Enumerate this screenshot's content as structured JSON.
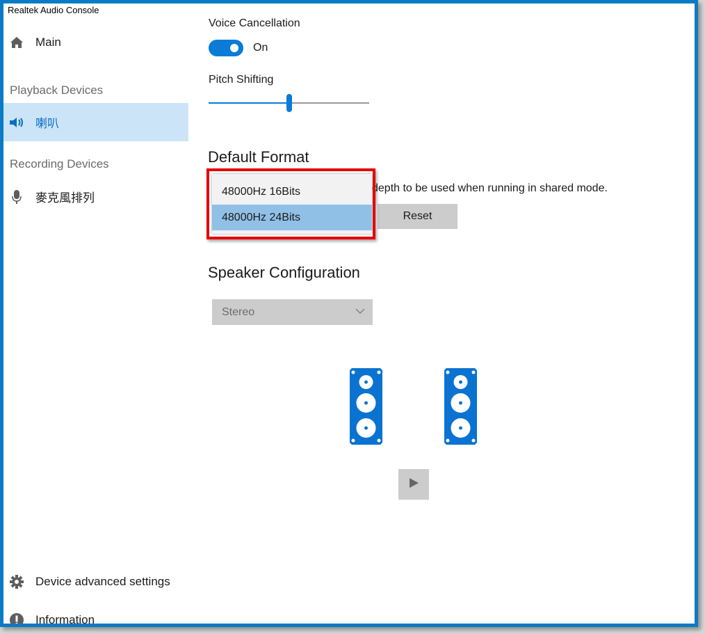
{
  "window": {
    "title": "Realtek Audio Console"
  },
  "sidebar": {
    "main": {
      "label": "Main",
      "icon": "home-icon"
    },
    "playback_header": "Playback Devices",
    "playback_devices": [
      {
        "label": "喇叭",
        "icon": "speaker-icon",
        "selected": true
      }
    ],
    "recording_header": "Recording Devices",
    "recording_devices": [
      {
        "label": "麥克風排列",
        "icon": "microphone-icon",
        "selected": false
      }
    ],
    "advanced": {
      "label": "Device advanced settings",
      "icon": "gear-icon"
    },
    "information": {
      "label": "Information",
      "icon": "info-icon"
    }
  },
  "content": {
    "voice_cancellation": {
      "label": "Voice Cancellation",
      "state_text": "On",
      "enabled": true
    },
    "pitch_shifting": {
      "label": "Pitch Shifting",
      "value_fraction": 0.5
    },
    "default_format": {
      "heading": "Default Format",
      "description_visible": "depth to be used when running in shared mode.",
      "options": [
        {
          "label": "48000Hz 16Bits",
          "selected": false
        },
        {
          "label": "48000Hz 24Bits",
          "selected": true
        }
      ],
      "reset_label": "Reset"
    },
    "speaker_configuration": {
      "heading": "Speaker Configuration",
      "selected": "Stereo",
      "speakers": [
        "left-speaker",
        "right-speaker"
      ],
      "play_label": "play-test"
    }
  },
  "colors": {
    "accent": "#0a7bd6",
    "selection": "#cce4f7",
    "highlight": "#e50000",
    "frame": "#0a7bc4"
  }
}
